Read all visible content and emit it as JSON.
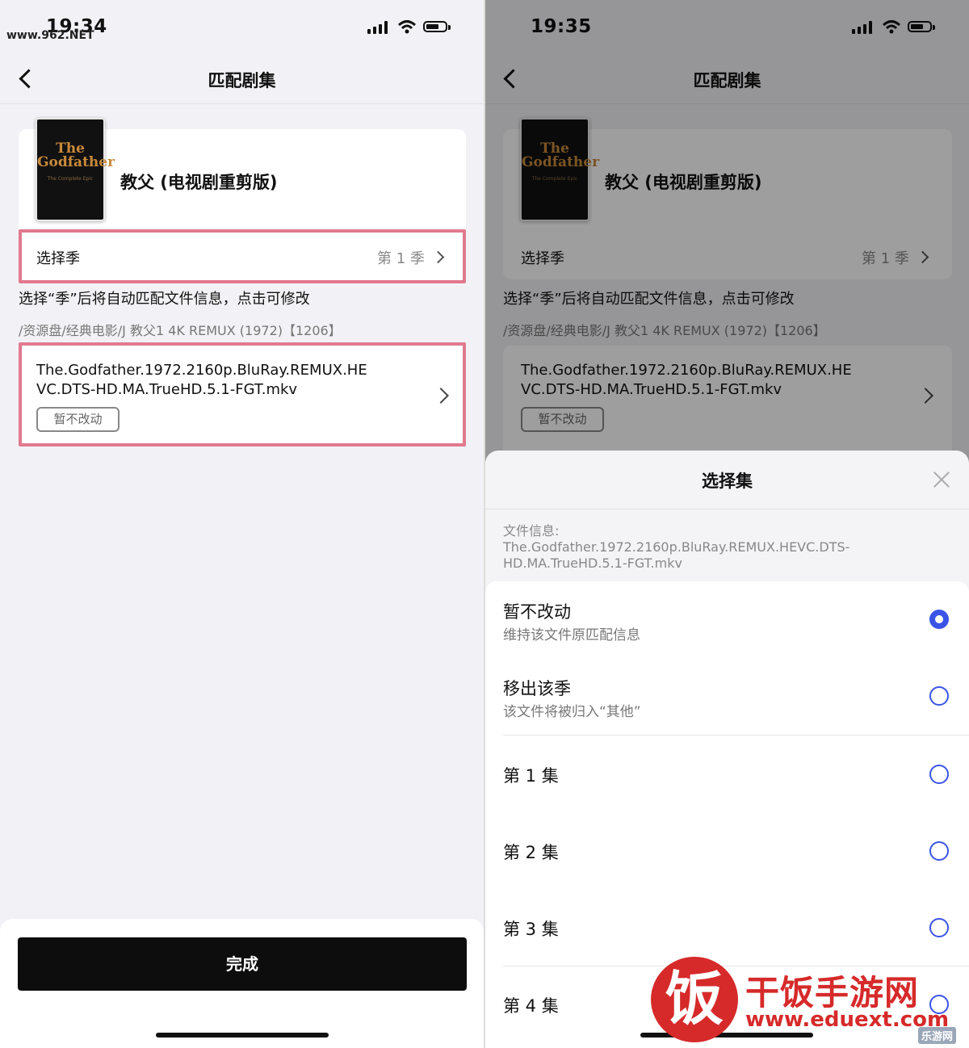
{
  "left": {
    "status": {
      "time": "19:34",
      "watermark": "www.962.NET"
    },
    "nav": {
      "title": "匹配剧集"
    },
    "show": {
      "title": "教父 (电视剧重剪版)",
      "poster_line1": "The",
      "poster_line2": "Godfather",
      "poster_sub": "The Complete Epic"
    },
    "season_row": {
      "label": "选择季",
      "value": "第 1 季"
    },
    "hint": "选择“季”后将自动匹配文件信息，点击可修改",
    "path": "/资源盘/经典电影/J 教父1 4K REMUX (1972)【1206】",
    "file": {
      "name_line1": "The.Godfather.1972.2160p.BluRay.REMUX.HE",
      "name_line2": "VC.DTS-HD.MA.TrueHD.5.1-FGT.mkv",
      "tag": "暂不改动"
    },
    "done_label": "完成"
  },
  "right": {
    "status": {
      "time": "19:35"
    },
    "nav": {
      "title": "匹配剧集"
    },
    "show": {
      "title": "教父 (电视剧重剪版)",
      "poster_line1": "The",
      "poster_line2": "Godfather",
      "poster_sub": "The Complete Epic"
    },
    "season_row": {
      "label": "选择季",
      "value": "第 1 季"
    },
    "hint": "选择“季”后将自动匹配文件信息，点击可修改",
    "path": "/资源盘/经典电影/J 教父1 4K REMUX (1972)【1206】",
    "file": {
      "name_line1": "The.Godfather.1972.2160p.BluRay.REMUX.HE",
      "name_line2": "VC.DTS-HD.MA.TrueHD.5.1-FGT.mkv",
      "tag": "暂不改动"
    },
    "sheet": {
      "title": "选择集",
      "file_info_label": "文件信息:",
      "file_info_line1": "The.Godfather.1972.2160p.BluRay.REMUX.HEVC.DTS-",
      "file_info_line2": "HD.MA.TrueHD.5.1-FGT.mkv",
      "options": [
        {
          "title": "暂不改动",
          "sub": "维持该文件原匹配信息",
          "selected": true
        },
        {
          "title": "移出该季",
          "sub": "该文件将被归入“其他”",
          "selected": false
        },
        {
          "title": "第 1 集",
          "selected": false
        },
        {
          "title": "第 2 集",
          "selected": false
        },
        {
          "title": "第 3 集",
          "selected": false
        },
        {
          "title": "第 4 集",
          "selected": false
        }
      ]
    },
    "watermark": {
      "logo_char": "饭",
      "site_name": "干饭手游网",
      "url": "www.eduext.com",
      "badge": "乐游网"
    }
  },
  "colors": {
    "highlight": "#e0798e",
    "accent": "#3a54e6",
    "button": "#0d0d0d"
  }
}
